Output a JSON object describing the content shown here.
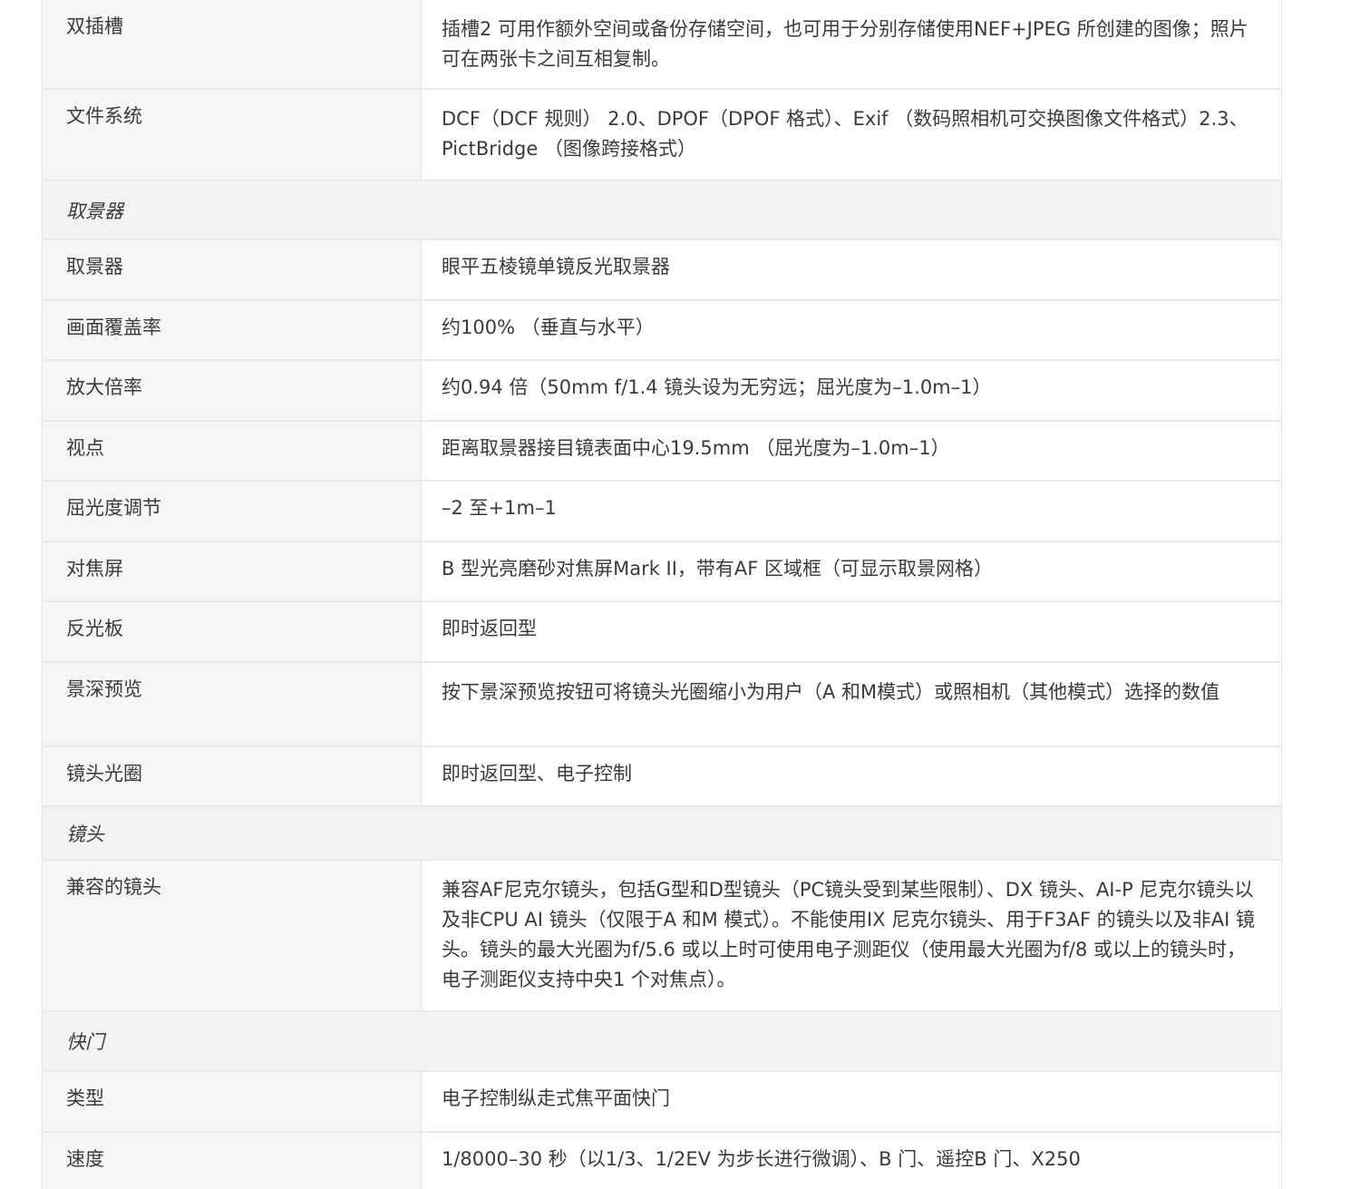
{
  "rows": [
    {
      "type": "row",
      "label": "双插槽",
      "value": "插槽2 可用作额外空间或备份存储空间，也可用于分别存储使用NEF+JPEG 所创建的图像；照片可在两张卡之间互相复制。",
      "height": 99
    },
    {
      "type": "row",
      "label": "文件系统",
      "value": "DCF（DCF 规则） 2.0、DPOF（DPOF 格式）、Exif （数码照相机可交换图像文件格式）2.3、PictBridge （图像跨接格式）",
      "height": 101
    },
    {
      "type": "section",
      "label": "取景器",
      "height": 65
    },
    {
      "type": "row",
      "label": "取景器",
      "value": "眼平五棱镜单镜反光取景器",
      "height": 67
    },
    {
      "type": "row",
      "label": "画面覆盖率",
      "value": "约100% （垂直与水平）",
      "height": 66
    },
    {
      "type": "row",
      "label": "放大倍率",
      "value": "约0.94 倍（50mm f/1.4 镜头设为无穷远；屈光度为–1.0m–1）",
      "height": 67
    },
    {
      "type": "row",
      "label": "视点",
      "value": "距离取景器接目镜表面中心19.5mm （屈光度为–1.0m–1）",
      "height": 66
    },
    {
      "type": "row",
      "label": "屈光度调节",
      "value": "–2 至+1m–1",
      "height": 67
    },
    {
      "type": "row",
      "label": "对焦屏",
      "value": "B 型光亮磨砂对焦屏Mark II，带有AF 区域框（可显示取景网格）",
      "height": 66
    },
    {
      "type": "row",
      "label": "反光板",
      "value": "即时返回型",
      "height": 67
    },
    {
      "type": "row",
      "label": "景深预览",
      "value": "按下景深预览按钮可将镜头光圈缩小为用户（A 和M模式）或照相机（其他模式）选择的数值",
      "height": 93
    },
    {
      "type": "row",
      "label": "镜头光圈",
      "value": "即时返回型、电子控制",
      "height": 66
    },
    {
      "type": "section",
      "label": "镜头",
      "height": 59
    },
    {
      "type": "row",
      "label": "兼容的镜头",
      "value": "兼容AF尼克尔镜头，包括G型和D型镜头（PC镜头受到某些限制）、DX 镜头、AI-P 尼克尔镜头以及非CPU AI 镜头（仅限于A 和M 模式）。不能使用IX 尼克尔镜头、用于F3AF 的镜头以及非AI 镜头。镜头的最大光圈为f/5.6 或以上时可使用电子测距仪（使用最大光圈为f/8 或以上的镜头时，电子测距仪支持中央1 个对焦点）。",
      "height": 167
    },
    {
      "type": "section",
      "label": "快门",
      "height": 66
    },
    {
      "type": "row",
      "label": "类型",
      "value": "电子控制纵走式焦平面快门",
      "height": 67
    },
    {
      "type": "row",
      "label": "速度",
      "value": "1/8000–30 秒（以1/3、1/2EV 为步长进行微调）、B 门、遥控B 门、X250",
      "height": 66
    }
  ]
}
